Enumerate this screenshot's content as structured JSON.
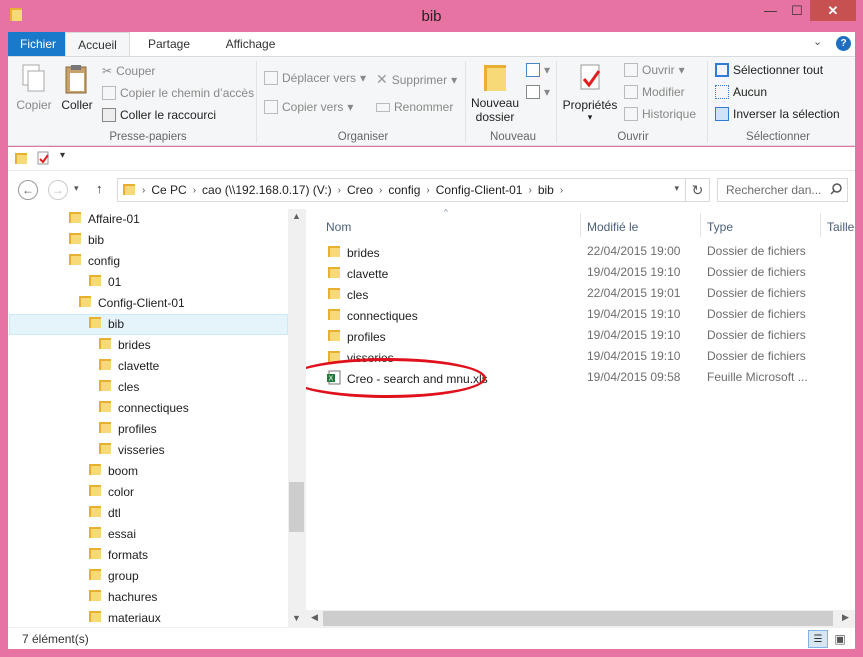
{
  "window": {
    "title": "bib"
  },
  "ribbon_tabs": [
    "Fichier",
    "Accueil",
    "Partage",
    "Affichage"
  ],
  "ribbon": {
    "clipboard": {
      "label": "Presse-papiers",
      "copier": "Copier",
      "coller": "Coller",
      "couper": "Couper",
      "copier_chemin": "Copier le chemin d’accès",
      "coller_raccourci": "Coller le raccourci"
    },
    "organiser": {
      "label": "Organiser",
      "deplacer": "Déplacer vers",
      "copier_vers": "Copier vers",
      "supprimer": "Supprimer",
      "renommer": "Renommer"
    },
    "nouveau": {
      "label": "Nouveau",
      "nouveau_dossier_1": "Nouveau",
      "nouveau_dossier_2": "dossier"
    },
    "ouvrir": {
      "label": "Ouvrir",
      "proprietes": "Propriétés",
      "ouvrir": "Ouvrir",
      "modifier": "Modifier",
      "historique": "Historique"
    },
    "selectionner": {
      "label": "Sélectionner",
      "tout": "Sélectionner tout",
      "aucun": "Aucun",
      "inverser": "Inverser la sélection"
    }
  },
  "address": {
    "crumbs": [
      "Ce PC",
      "cao (\\\\192.168.0.17) (V:)",
      "Creo",
      "config",
      "Config-Client-01",
      "bib"
    ]
  },
  "search": {
    "placeholder": "Rechercher dan..."
  },
  "tree": [
    "Affaire-01",
    "bib",
    "config",
    "01",
    "Config-Client-01",
    "bib",
    "brides",
    "clavette",
    "cles",
    "connectiques",
    "profiles",
    "visseries",
    "boom",
    "color",
    "dtl",
    "essai",
    "formats",
    "group",
    "hachures",
    "materiaux"
  ],
  "columns": {
    "name": "Nom",
    "modified": "Modifié le",
    "type": "Type",
    "size": "Taille"
  },
  "files": [
    {
      "name": "brides",
      "date": "22/04/2015 19:00",
      "type": "Dossier de fichiers"
    },
    {
      "name": "clavette",
      "date": "19/04/2015 19:10",
      "type": "Dossier de fichiers"
    },
    {
      "name": "cles",
      "date": "22/04/2015 19:01",
      "type": "Dossier de fichiers"
    },
    {
      "name": "connectiques",
      "date": "19/04/2015 19:10",
      "type": "Dossier de fichiers"
    },
    {
      "name": "profiles",
      "date": "19/04/2015 19:10",
      "type": "Dossier de fichiers"
    },
    {
      "name": "visseries",
      "date": "19/04/2015 19:10",
      "type": "Dossier de fichiers"
    },
    {
      "name": "Creo - search and mnu.xls",
      "date": "19/04/2015 09:58",
      "type": "Feuille Microsoft ..."
    }
  ],
  "status": {
    "count": "7 élément(s)"
  },
  "colors": {
    "frame": "#e773a3",
    "accent": "#1979ca",
    "highlight": "#e0101c",
    "folder": "#f4c950"
  }
}
